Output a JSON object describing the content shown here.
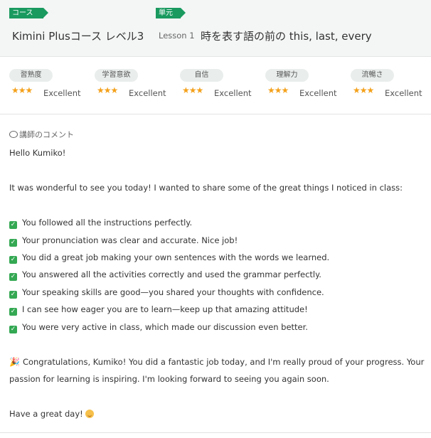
{
  "header": {
    "course_tag": "コース",
    "unit_tag": "単元",
    "course_name": "Kimini Plusコース レベル3",
    "lesson_label": "Lesson 1",
    "lesson_title": "時を表す語の前の this, last, every"
  },
  "ratings": [
    {
      "category": "習熟度",
      "stars": "★★★",
      "value": "Excellent"
    },
    {
      "category": "学習意欲",
      "stars": "★★★",
      "value": "Excellent"
    },
    {
      "category": "自信",
      "stars": "★★★",
      "value": "Excellent"
    },
    {
      "category": "理解力",
      "stars": "★★★",
      "value": "Excellent"
    },
    {
      "category": "流暢さ",
      "stars": "★★★",
      "value": "Excellent"
    }
  ],
  "comment": {
    "heading": "講師のコメント",
    "greeting": "Hello Kumiko!",
    "intro": "It was wonderful to see you today! I wanted to share some of the great things I noticed in class:",
    "points": [
      "You followed all the instructions perfectly.",
      "Your pronunciation was clear and accurate. Nice job!",
      "You did a great job making your own sentences with the words we learned.",
      "You answered all the activities correctly and used the grammar perfectly.",
      "Your speaking skills are good—you shared your thoughts with confidence.",
      "I can see how eager you are to learn—keep up that amazing attitude!",
      "You were very active in class, which made our discussion even better."
    ],
    "closing_line1": "Congratulations, Kumiko! You did a fantastic job today, and I'm really proud of your progress. Your",
    "closing_line2": "passion for learning is inspiring. I'm looking forward to seeing you again soon.",
    "signoff": "Have a great day!"
  },
  "colors": {
    "accent_green": "#1a9a5f",
    "star_orange": "#f4a11b",
    "check_green": "#34a853"
  }
}
